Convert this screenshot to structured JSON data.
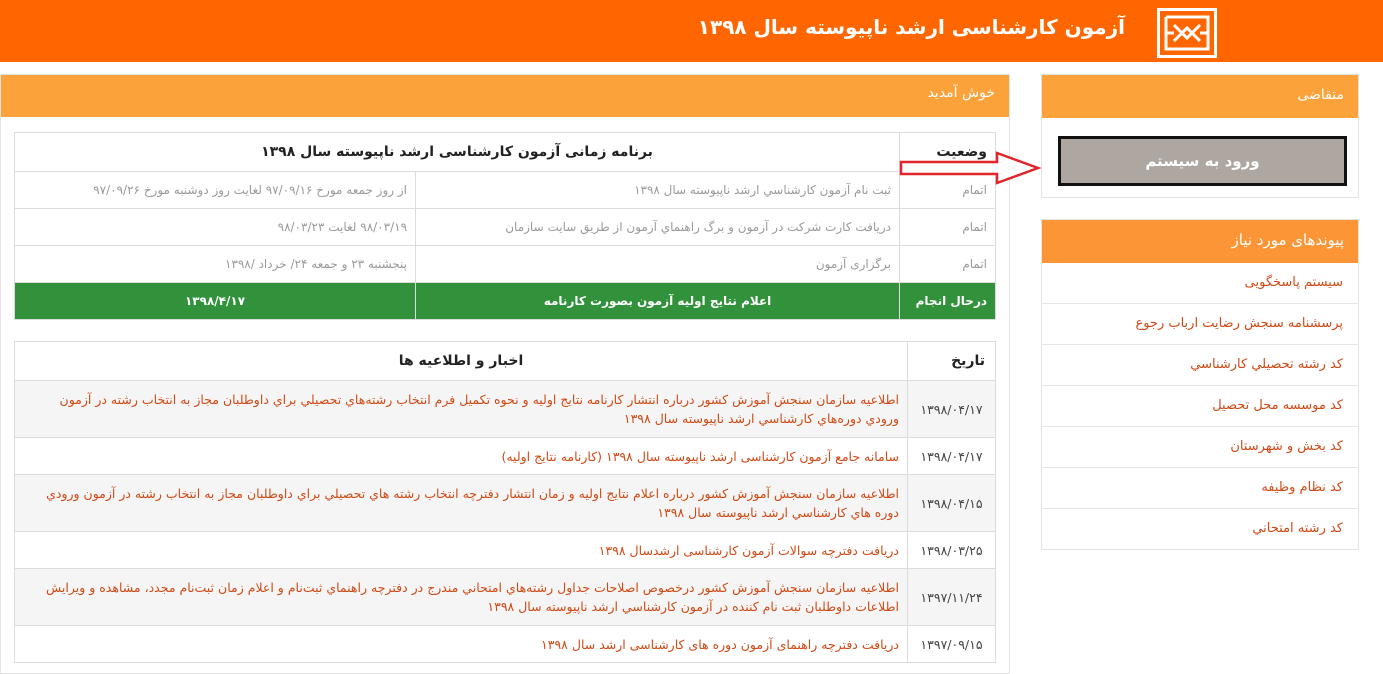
{
  "header": {
    "title": "آزمون کارشناسی ارشد ناپیوسته سال ۱۳۹۸"
  },
  "main": {
    "panel_title": "خوش آمدید",
    "schedule": {
      "status_header": "وضعیت",
      "title": "برنامه زمانی آزمون کارشناسی ارشد ناپیوسته سال ۱۳۹۸",
      "rows": [
        {
          "status": "اتمام",
          "activity": "ثبت نام آزمون کارشناسي ارشد ناپيوسته سال ۱۳۹۸",
          "time": "از روز جمعه مورخ ۹۷/۰۹/۱۶ لغایت روز دوشنبه مورخ ۹۷/۰۹/۲۶"
        },
        {
          "status": "اتمام",
          "activity": "دريافت کارت شرکت در آزمون و برگ راهنماي آزمون از طريق سايت سازمان",
          "time": "۹۸/۰۳/۱۹ لغایت ۹۸/۰۳/۲۳"
        },
        {
          "status": "اتمام",
          "activity": "برگزاری آزمون",
          "time": "پنجشنبه ۲۳ و جمعه ۲۴/ خرداد /۱۳۹۸"
        },
        {
          "status": "درحال انجام",
          "activity": "اعلام نتایج اولیه آزمون بصورت کارنامه",
          "time": "۱۳۹۸/۴/۱۷"
        }
      ]
    },
    "news": {
      "date_header": "تاریخ",
      "title_header": "اخبار و اطلاعیه ها",
      "rows": [
        {
          "date": "۱۳۹۸/۰۴/۱۷",
          "text": "اطلاعيه سازمان سنجش آموزش كشور درباره انتشار كارنامه نتايج اوليه و نحوه تكميل فرم انتخاب رشته‌هاي تحصيلي براي داوطلبان مجاز به انتخاب رشته در آزمون ورودي دوره‌هاي كارشناسي ارشد ناپيوسته سال ۱۳۹۸"
        },
        {
          "date": "۱۳۹۸/۰۴/۱۷",
          "text": "سامانه جامع آزمون کارشناسی ارشد ناپیوسته سال ۱۳۹۸ (کارنامه نتایج اولیه)"
        },
        {
          "date": "۱۳۹۸/۰۴/۱۵",
          "text": "اطلاعيه سازمان سنجش آموزش كشور درباره اعلام نتايج اوليه و زمان انتشار دفترچه انتخاب رشته هاي تحصيلي براي داوطلبان مجاز به انتخاب رشته در آزمون ورودي دوره هاي كارشناسي ارشد ناپيوسته سال ۱۳۹۸"
        },
        {
          "date": "۱۳۹۸/۰۳/۲۵",
          "text": "دریافت دفترچه سوالات آزمون کارشناسی ارشدسال ۱۳۹۸"
        },
        {
          "date": "۱۳۹۷/۱۱/۲۴",
          "text": "اطلاعيه سازمان سنجش آموزش كشور درخصوص اصلاحات جداول رشته‌هاي امتحاني مندرج در دفترچه راهنماي ثبت‌نام و اعلام زمان ثبت‌نام مجدد، مشاهده و ويرايش اطلاعات داوطلبان ثبت نام كننده در آزمون كارشناسي ارشد ناپيوسته سال ۱۳۹۸"
        },
        {
          "date": "۱۳۹۷/۰۹/۱۵",
          "text": "دریافت دفترچه راهنمای آزمون دوره های کارشناسی ارشد سال ۱۳۹۸"
        }
      ]
    }
  },
  "sidebar": {
    "applicant": {
      "title": "متقاضی",
      "login_label": "ورود به سیستم"
    },
    "links": {
      "title": "پیوندهای مورد نیاز",
      "items": [
        "سیستم پاسخگویی",
        "پرسشنامه سنجش رضایت ارباب رجوع",
        "کد رشته تحصيلي کارشناسي",
        "کد موسسه محل تحصیل",
        "کد بخش و شهرستان",
        "کد نظام وظیفه",
        "کد رشته امتحاني"
      ]
    }
  },
  "colors": {
    "header": "#ff6600",
    "panel_head": "#fba33a",
    "current_row": "#31923b",
    "link": "#d04a16",
    "login_button": "#aea7a1",
    "arrow": "#e0262b"
  }
}
